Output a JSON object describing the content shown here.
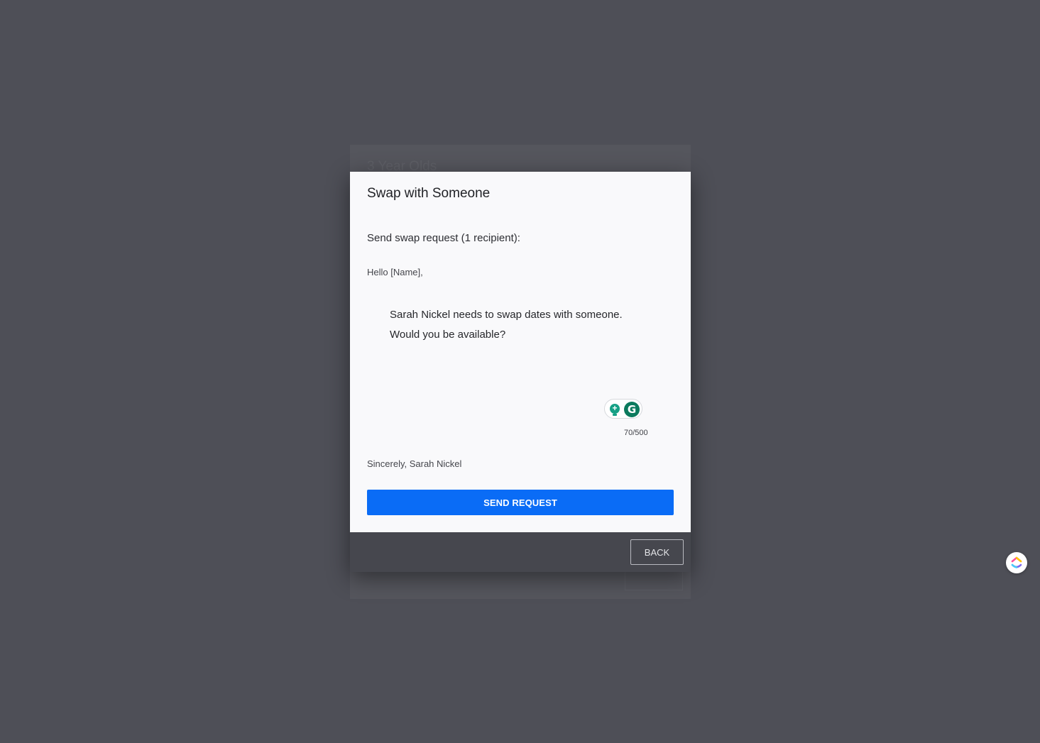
{
  "background_card": {
    "title": "3 Year Olds"
  },
  "modal": {
    "title": "Swap with Someone",
    "recipient_line": "Send swap request (1 recipient):",
    "greeting": "Hello [Name],",
    "message": "Sarah Nickel needs to swap dates with someone.\nWould you be available?",
    "char_count": "70/500",
    "signature": "Sincerely, Sarah Nickel",
    "send_label": "SEND REQUEST",
    "back_label": "BACK"
  },
  "writing_assistant": {
    "suggestion_icon": "lightbulb-icon",
    "brand_icon": "grammarly-icon",
    "brand_letter": "G"
  },
  "launcher": {
    "icon": "clickup-icon"
  },
  "colors": {
    "primary": "#0a6cf6",
    "overlay": "#4e4f57",
    "assistant_green": "#15a085"
  }
}
